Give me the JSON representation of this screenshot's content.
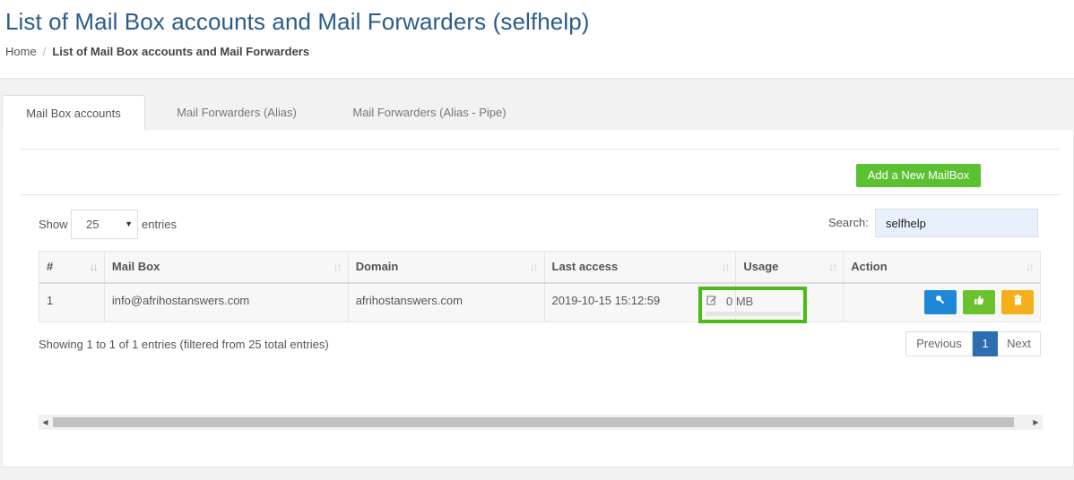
{
  "header": {
    "title": "List of Mail Box accounts and Mail Forwarders (selfhelp)",
    "breadcrumb": {
      "home": "Home",
      "separator": "/",
      "current": "List of Mail Box accounts and Mail Forwarders"
    }
  },
  "tabs": [
    {
      "label": "Mail Box accounts",
      "active": true
    },
    {
      "label": "Mail Forwarders (Alias)",
      "active": false
    },
    {
      "label": "Mail Forwarders (Alias - Pipe)",
      "active": false
    }
  ],
  "toolbar": {
    "add_label": "Add a New MailBox"
  },
  "length": {
    "show_label": "Show",
    "value": "25",
    "entries_label": "entries"
  },
  "search": {
    "label": "Search:",
    "value": "selfhelp"
  },
  "table": {
    "columns": [
      "#",
      "Mail Box",
      "Domain",
      "Last access",
      "Usage",
      "Action"
    ],
    "rows": [
      {
        "num": "1",
        "mailbox": "info@afrihostanswers.com",
        "domain": "afrihostanswers.com",
        "last_access": "2019-10-15 15:12:59",
        "usage": "0 MB"
      }
    ]
  },
  "info": "Showing 1 to 1 of 1 entries (filtered from 25 total entries)",
  "pagination": {
    "previous": "Previous",
    "current": "1",
    "next": "Next"
  },
  "icons": {
    "sort": "sort-icon",
    "edit": "edit-icon",
    "key": "key-icon",
    "thumbs_up": "thumbs-up-icon",
    "trash": "trash-icon"
  },
  "colors": {
    "title": "#2b5c8a",
    "add_button": "#5cc132",
    "highlight": "#4cbb17",
    "btn_blue": "#1e88d8",
    "btn_green": "#6cc22d",
    "btn_orange": "#f4b01a",
    "page_active": "#2d6eb0"
  }
}
